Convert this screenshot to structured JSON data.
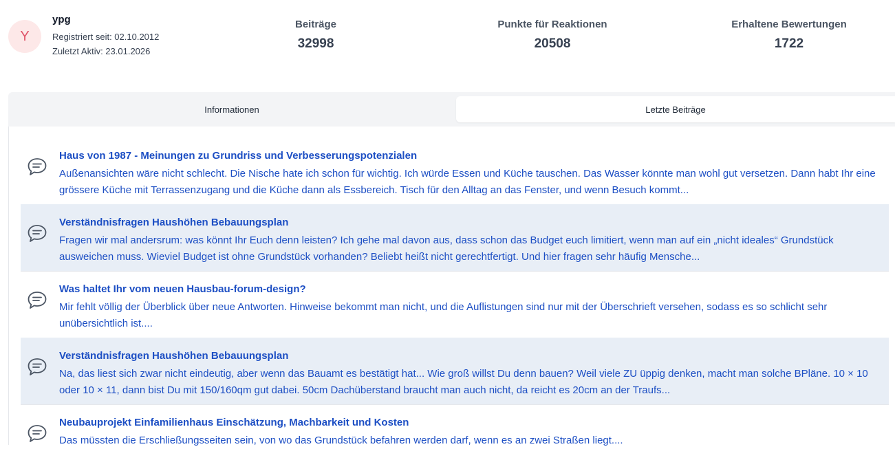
{
  "profile": {
    "avatar_letter": "Y",
    "username": "ypg",
    "registered": "Registriert seit: 02.10.2012",
    "last_active": "Zuletzt Aktiv: 23.01.2026"
  },
  "stats": [
    {
      "label": "Beiträge",
      "value": "32998"
    },
    {
      "label": "Punkte für Reaktionen",
      "value": "20508"
    },
    {
      "label": "Erhaltene Bewertungen",
      "value": "1722"
    }
  ],
  "tabs": [
    {
      "label": "Informationen",
      "active": false
    },
    {
      "label": "Letzte Beiträge",
      "active": true
    }
  ],
  "posts": [
    {
      "icon": "chat-bubble-icon",
      "title": "Haus von 1987 - Meinungen zu Grundriss und Verbesserungspotenzialen",
      "excerpt": "Außenansichten wäre nicht schlecht. Die Nische hate ich schon für wichtig. Ich würde Essen und Küche tauschen. Das Wasser könnte man wohl gut versetzen. Dann habt Ihr eine grössere Küche mit Terrassenzugang und die Küche dann als Essbereich. Tisch für den Alltag an das Fenster, und wenn Besuch kommt..."
    },
    {
      "icon": "chat-bubble-icon",
      "title": "Verständnisfragen Haushöhen Bebauungsplan",
      "excerpt": "Fragen wir mal andersrum: was könnt Ihr Euch denn leisten? Ich gehe mal davon aus, dass schon das Budget euch limitiert, wenn man auf ein „nicht ideales“ Grundstück ausweichen muss.  Wieviel Budget ist ohne Grundstück vorhanden? Beliebt heißt nicht gerechtfertigt. Und hier fragen sehr häufig Mensche..."
    },
    {
      "icon": "chat-bubble-icon",
      "title": "Was haltet Ihr vom neuen Hausbau-forum-design?",
      "excerpt": "Mir fehlt völlig der Überblick über neue Antworten. Hinweise bekommt man nicht, und die Auflistungen sind nur mit der Überschrieft versehen, sodass es so schlicht sehr unübersichtlich ist...."
    },
    {
      "icon": "chat-bubble-icon",
      "title": "Verständnisfragen Haushöhen Bebauungsplan",
      "excerpt": "Na, das liest sich zwar nicht eindeutig, aber wenn das Bauamt es bestätigt hat... Wie groß willst Du denn bauen? Weil viele ZU üppig denken, macht man solche BPläne. 10 × 10 oder 10 × 11, dann bist Du mit 150/160qm gut dabei. 50cm Dachüberstand braucht man auch nicht, da reicht es 20cm an der Traufs..."
    },
    {
      "icon": "chat-bubble-icon",
      "title": "Neubauprojekt Einfamilienhaus Einschätzung, Machbarkeit und Kosten",
      "excerpt": "Das müssten die Erschließungsseiten sein, von wo das Grundstück befahren werden darf, wenn es an zwei Straßen liegt...."
    }
  ],
  "colors": {
    "link": "#1d4fc4",
    "alt_row": "#e8eef6",
    "avatar_bg": "#fde8e8",
    "avatar_fg": "#e0556a"
  }
}
